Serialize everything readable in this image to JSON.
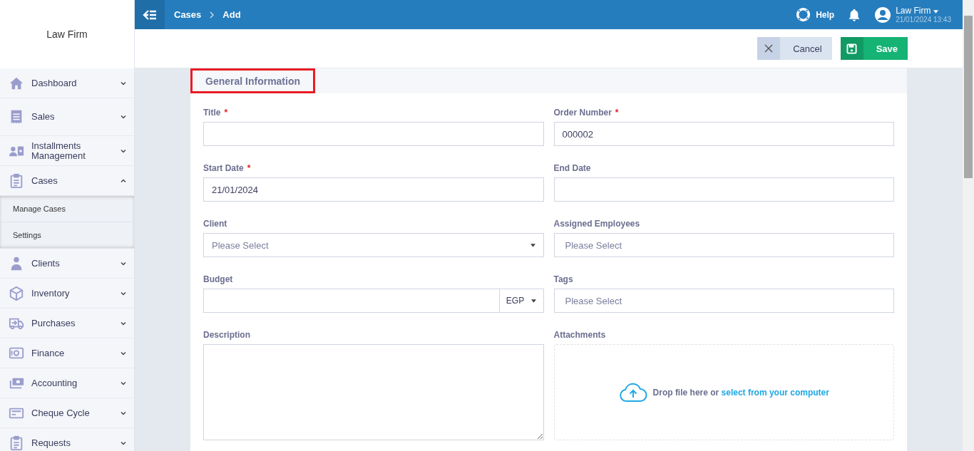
{
  "sidebar": {
    "brand": "Law Firm",
    "items": [
      {
        "label": "Dashboard",
        "expanded": false
      },
      {
        "label": "Sales",
        "expanded": false
      },
      {
        "label": "Installments Management",
        "expanded": false
      },
      {
        "label": "Cases",
        "expanded": true,
        "children": [
          {
            "label": "Manage Cases"
          },
          {
            "label": "Settings"
          }
        ]
      },
      {
        "label": "Clients",
        "expanded": false
      },
      {
        "label": "Inventory",
        "expanded": false
      },
      {
        "label": "Purchases",
        "expanded": false
      },
      {
        "label": "Finance",
        "expanded": false
      },
      {
        "label": "Accounting",
        "expanded": false
      },
      {
        "label": "Cheque Cycle",
        "expanded": false
      },
      {
        "label": "Requests",
        "expanded": false
      }
    ]
  },
  "topbar": {
    "breadcrumb": [
      "Cases",
      "Add"
    ],
    "help": "Help",
    "user": "Law Firm",
    "datetime": "21/01/2024 13:43"
  },
  "toolbar": {
    "buttons": [
      {
        "kind": "cancel",
        "label": "Cancel"
      },
      {
        "kind": "save",
        "label": "Save"
      }
    ]
  },
  "section": {
    "title": "General Information",
    "highlighted": true
  },
  "fields": [
    {
      "kind": "input",
      "label": "Title",
      "required_mark": "*"
    },
    {
      "kind": "input",
      "label": "Order Number",
      "required_mark": "*",
      "value": "000002"
    },
    {
      "kind": "input",
      "label": "Start Date",
      "required_mark": "*",
      "value": "21/01/2024"
    },
    {
      "kind": "input",
      "label": "End Date"
    },
    {
      "kind": "select",
      "label": "Client",
      "placeholder": "Please Select"
    },
    {
      "kind": "multiselect",
      "label": "Assigned Employees",
      "placeholder": "Please Select"
    },
    {
      "kind": "currency",
      "label": "Budget",
      "currency": "EGP"
    },
    {
      "kind": "multiselect",
      "label": "Tags",
      "placeholder": "Please Select"
    },
    {
      "kind": "textarea",
      "label": "Description"
    },
    {
      "kind": "dropzone",
      "label": "Attachments",
      "text": "Drop file here or",
      "link": "select from your computer"
    }
  ]
}
